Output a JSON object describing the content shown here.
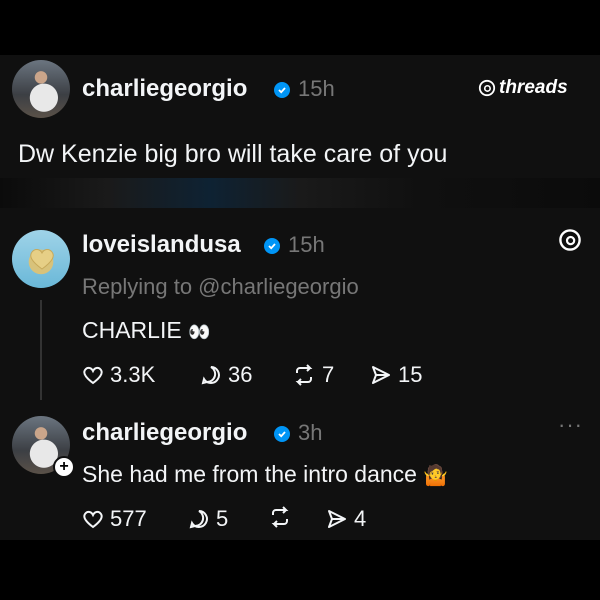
{
  "top_post": {
    "username": "charliegeorgio",
    "time": "15h",
    "brand": "threads",
    "text": "Dw Kenzie big bro will take care of you"
  },
  "reply_1": {
    "username": "loveislandusa",
    "time": "15h",
    "replying_to": "Replying to @charliegeorgio",
    "text": "CHARLIE",
    "emoji": "👀",
    "likes": "3.3K",
    "comments": "36",
    "reposts": "7",
    "shares": "15"
  },
  "reply_2": {
    "username": "charliegeorgio",
    "time": "3h",
    "text": "She had me from the intro dance",
    "emoji": "🤷",
    "likes": "577",
    "comments": "5",
    "shares": "4",
    "more": "···"
  },
  "colors": {
    "background": "#000000",
    "card": "#101010",
    "verified": "#0095f6",
    "muted": "#777777"
  }
}
